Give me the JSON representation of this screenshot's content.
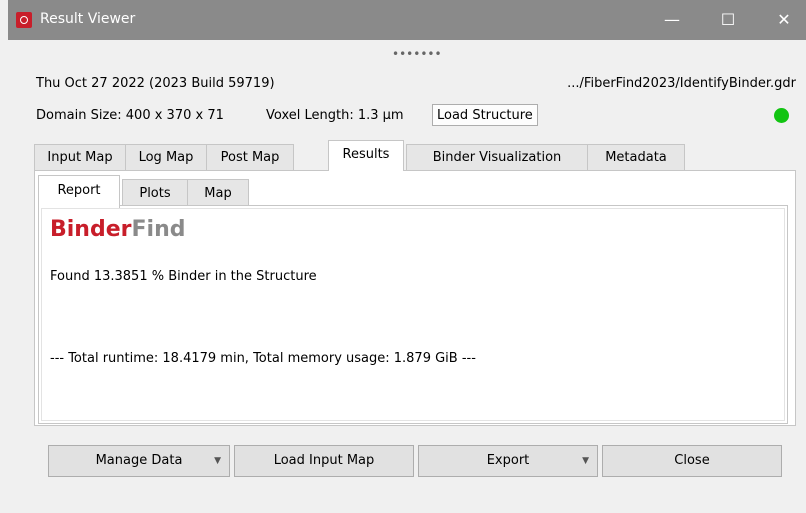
{
  "window": {
    "title": "Result Viewer",
    "controls": {
      "minimize": "—",
      "maximize": "☐",
      "close": "✕"
    }
  },
  "header": {
    "date_build": "Thu Oct 27 2022 (2023 Build 59719)",
    "file_path": ".../FiberFind2023/IdentifyBinder.gdr",
    "domain_size": "Domain Size: 400 x 370 x 71",
    "voxel_length": "Voxel Length: 1.3 µm",
    "load_structure_label": "Load Structure",
    "status_color": "#12c412"
  },
  "tabs": [
    {
      "label": "Input Map"
    },
    {
      "label": "Log Map"
    },
    {
      "label": "Post Map"
    },
    {
      "label": "Results"
    },
    {
      "label": "Binder Visualization"
    },
    {
      "label": "Metadata"
    }
  ],
  "subtabs": [
    {
      "label": "Report"
    },
    {
      "label": "Plots"
    },
    {
      "label": "Map"
    }
  ],
  "report": {
    "brand_part1": "Binder",
    "brand_part2": "Find",
    "brand_color_1": "#c81e2a",
    "brand_color_2": "#8a8a8a",
    "found_text": "Found 13.3851 % Binder in the Structure",
    "runtime_text": "--- Total runtime: 18.4179 min, Total memory usage: 1.879 GiB ---"
  },
  "buttons": {
    "manage_data": "Manage Data",
    "load_input_map": "Load Input Map",
    "export": "Export",
    "close": "Close"
  }
}
